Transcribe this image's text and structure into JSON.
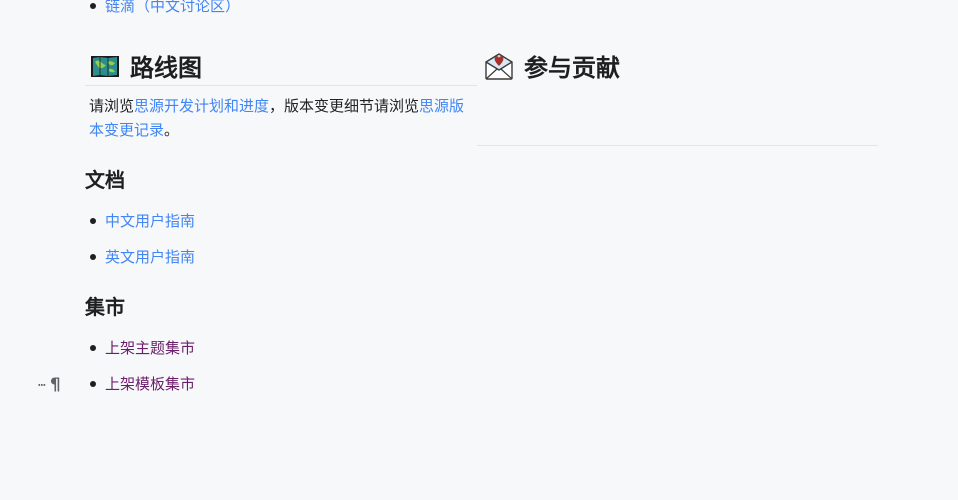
{
  "top_list": {
    "partial_item": "链滴（中文讨论区）"
  },
  "roadmap": {
    "title": "路线图",
    "text_before": "请浏览",
    "link1": "思源开发计划和进度",
    "text_middle": "，版本变更细节请浏览",
    "link2": "思源版本变更记录",
    "text_after": "。"
  },
  "docs": {
    "title": "文档",
    "items": [
      "中文用户指南",
      "英文用户指南"
    ]
  },
  "market": {
    "title": "集市",
    "items": [
      "上架主题集市",
      "上架模板集市"
    ]
  },
  "contribute": {
    "title": "参与贡献"
  },
  "gutter": {
    "drag_glyph": "⋯",
    "pilcrow_glyph": "¶"
  },
  "icons": {
    "roadmap": "world-map-icon",
    "contribute": "love-letter-icon",
    "drag": "drag-handle-icon",
    "block": "pilcrow-icon"
  },
  "colors": {
    "link": "#4285f4",
    "visited_link": "#6b1f6b",
    "text": "#222222",
    "background": "#f6f8fa"
  }
}
